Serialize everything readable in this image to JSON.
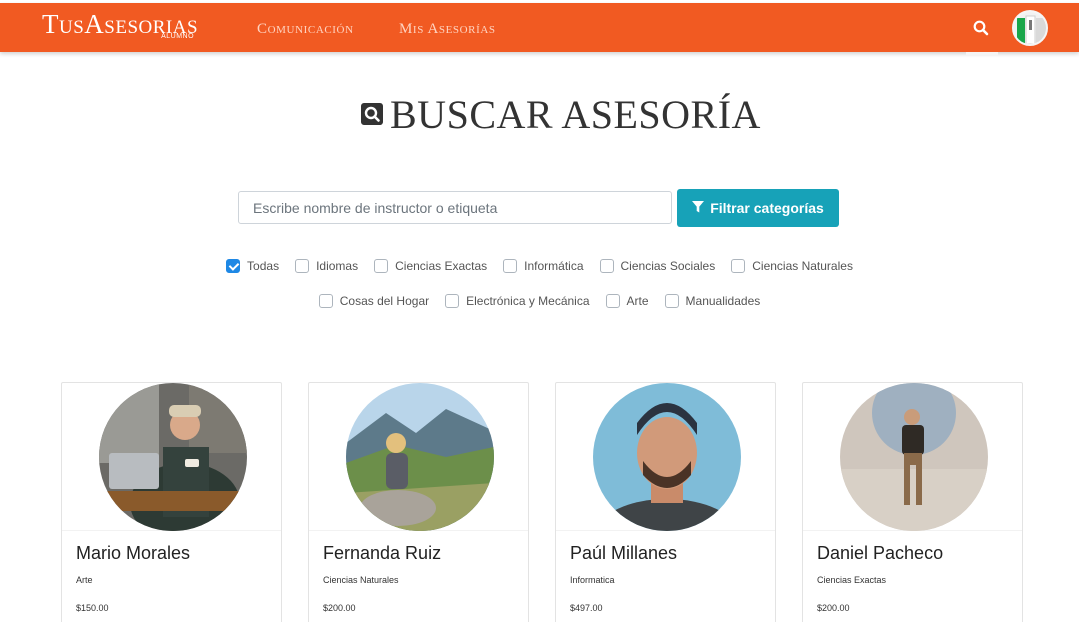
{
  "brand": {
    "name": "TusAsesorias",
    "sub": "ALUMNO"
  },
  "nav": {
    "links": [
      "Comunicación",
      "Mis Asesorías"
    ]
  },
  "page": {
    "title": "BUSCAR ASESORÍA"
  },
  "search": {
    "placeholder": "Escribe nombre de instructor o etiqueta",
    "button": "Filtrar categorías"
  },
  "categories": {
    "row1": [
      {
        "label": "Todas",
        "checked": true
      },
      {
        "label": "Idiomas",
        "checked": false
      },
      {
        "label": "Ciencias Exactas",
        "checked": false
      },
      {
        "label": "Informática",
        "checked": false
      },
      {
        "label": "Ciencias Sociales",
        "checked": false
      },
      {
        "label": "Ciencias Naturales",
        "checked": false
      }
    ],
    "row2": [
      {
        "label": "Cosas del Hogar",
        "checked": false
      },
      {
        "label": "Electrónica y Mecánica",
        "checked": false
      },
      {
        "label": "Arte",
        "checked": false
      },
      {
        "label": "Manualidades",
        "checked": false
      }
    ]
  },
  "cards": [
    {
      "name": "Mario Morales",
      "category": "Arte",
      "price": "$150.00"
    },
    {
      "name": "Fernanda Ruiz",
      "category": "Ciencias Naturales",
      "price": "$200.00"
    },
    {
      "name": "Paúl Millanes",
      "category": "Informatica",
      "price": "$497.00"
    },
    {
      "name": "Daniel Pacheco",
      "category": "Ciencias Exactas",
      "price": "$200.00"
    }
  ],
  "colors": {
    "navbar": "#f15a22",
    "filter_button": "#17a2b8",
    "checkbox": "#1e88e5"
  }
}
